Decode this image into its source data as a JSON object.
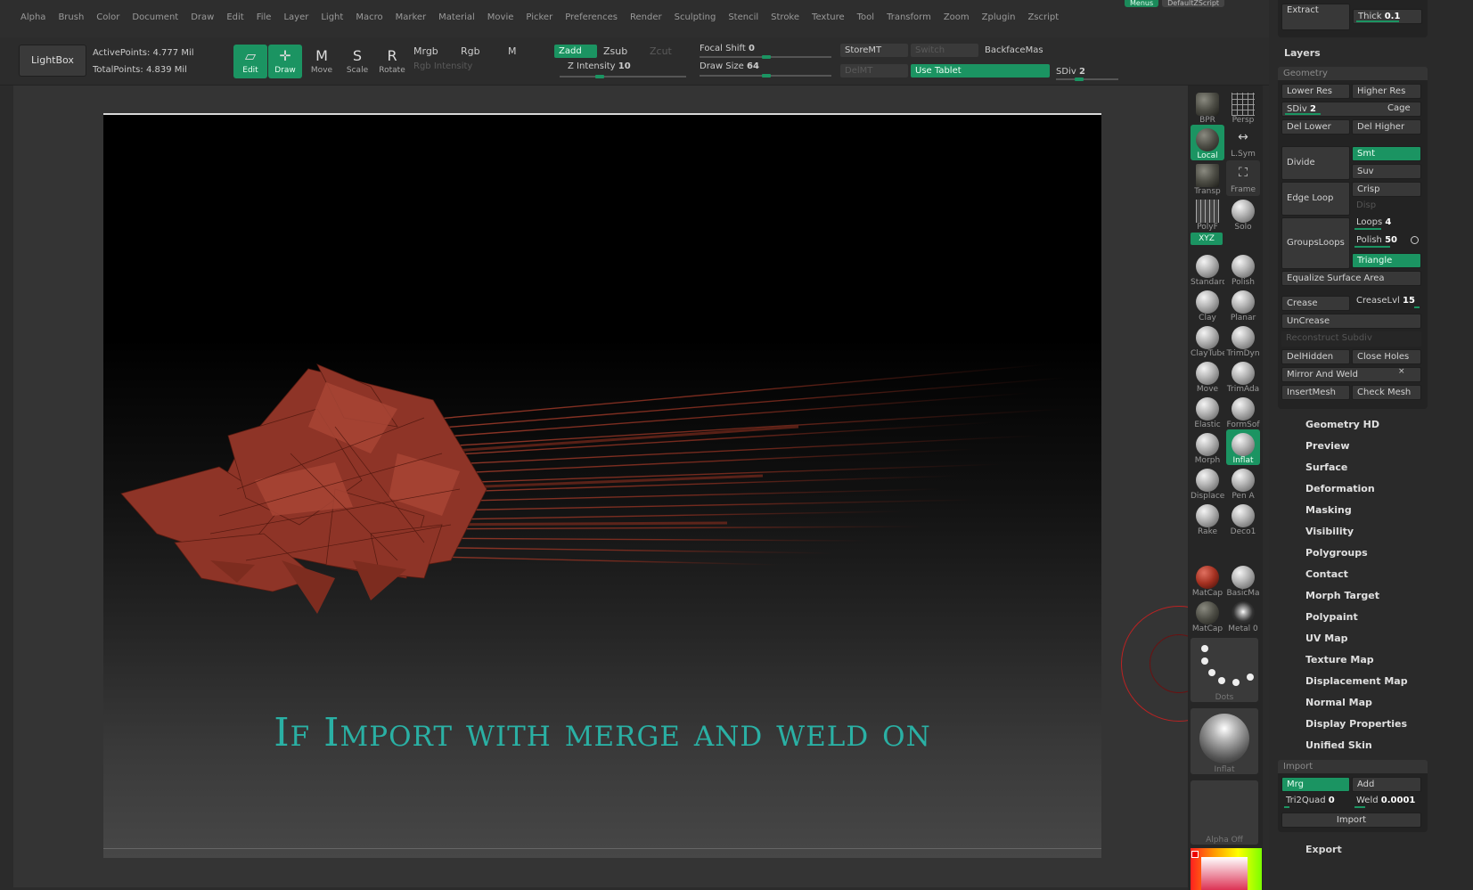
{
  "menubar": [
    "Alpha",
    "Brush",
    "Color",
    "Document",
    "Draw",
    "Edit",
    "File",
    "Layer",
    "Light",
    "Macro",
    "Marker",
    "Material",
    "Movie",
    "Picker",
    "Preferences",
    "Render",
    "Sculpting",
    "Stencil",
    "Stroke",
    "Texture",
    "Tool",
    "Transform",
    "Zoom",
    "Zplugin",
    "Zscript"
  ],
  "topright": {
    "menus": "Menus",
    "script": "DefaultZScript"
  },
  "shelf": {
    "lightbox": "LightBox",
    "active_points": "ActivePoints: 4.777  Mil",
    "total_points": "TotalPoints: 4.839  Mil",
    "edit": "Edit",
    "draw": "Draw",
    "move": "Move",
    "scale": "Scale",
    "rotate": "Rotate",
    "mrgb": "Mrgb",
    "rgb": "Rgb",
    "m": "M",
    "rgb_intensity": "Rgb  Intensity",
    "zadd": "Zadd",
    "zsub": "Zsub",
    "zcut": "Zcut",
    "z_intensity_label": "Z Intensity",
    "z_intensity": "10",
    "focal_shift_label": "Focal Shift",
    "focal_shift": "0",
    "draw_size_label": "Draw Size",
    "draw_size": "64",
    "store_mt": "StoreMT",
    "switch": "Switch",
    "backface": "BackfaceMas",
    "del_mt": "DelMT",
    "use_tablet": "Use Tablet",
    "sdiv_label": "SDiv",
    "sdiv": "2"
  },
  "canvas": {
    "caption": "If Import with merge and weld on"
  },
  "palette": {
    "view": [
      {
        "name": "bpr-button",
        "label": "BPR"
      },
      {
        "name": "persp-button",
        "label": "Persp"
      },
      {
        "name": "local-button",
        "label": "Local"
      },
      {
        "name": "lsym-button",
        "label": "L.Sym"
      },
      {
        "name": "transp-button",
        "label": "Transp"
      },
      {
        "name": "frame-button",
        "label": "Frame"
      },
      {
        "name": "polyf-button",
        "label": "PolyF"
      },
      {
        "name": "solo-button",
        "label": "Solo"
      }
    ],
    "xyz": "XYZ",
    "brushes": [
      "Standard",
      "Polish",
      "Clay",
      "Planar",
      "ClayTubes",
      "TrimDyn",
      "Move",
      "TrimAda",
      "Elastic",
      "FormSof",
      "Morph",
      "Inflat",
      "Displace",
      "Pen A",
      "Rake",
      "Deco1"
    ],
    "materials": [
      "MatCap",
      "BasicMa",
      "MatCap",
      "Metal 0"
    ],
    "stroke_label": "Dots",
    "alpha_brush_label": "Inflat",
    "alpha_label": "Alpha Off"
  },
  "rpanel": {
    "extract": "Extract",
    "thick_label": "Thick",
    "thick": "0.1",
    "layers": "Layers",
    "geometry": {
      "title": "Geometry",
      "lower_res": "Lower Res",
      "higher_res": "Higher Res",
      "sdiv_label": "SDiv",
      "sdiv": "2",
      "cage": "Cage",
      "del_lower": "Del Lower",
      "del_higher": "Del Higher",
      "divide": "Divide",
      "smt": "Smt",
      "suv": "Suv",
      "edge_loop": "Edge Loop",
      "crisp": "Crisp",
      "disp": "Disp",
      "groups_loops": "GroupsLoops",
      "loops_label": "Loops",
      "loops": "4",
      "polish_label": "Polish",
      "polish": "50",
      "triangle": "Triangle",
      "equalize": "Equalize Surface Area",
      "crease": "Crease",
      "crease_lvl_label": "CreaseLvl",
      "crease_lvl": "15",
      "uncrease": "UnCrease",
      "reconstruct": "Reconstruct Subdiv",
      "delhidden": "DelHidden",
      "close_holes": "Close Holes",
      "mirror_weld": "Mirror And Weld",
      "insertmesh": "InsertMesh",
      "check_mesh": "Check Mesh"
    },
    "sections": [
      "Geometry HD",
      "Preview",
      "Surface",
      "Deformation",
      "Masking",
      "Visibility",
      "Polygroups",
      "Contact",
      "Morph Target",
      "Polypaint",
      "UV Map",
      "Texture Map",
      "Displacement Map",
      "Normal Map",
      "Display Properties",
      "Unified Skin"
    ],
    "import": {
      "title": "Import",
      "mrg": "Mrg",
      "add": "Add",
      "tri2quad_label": "Tri2Quad",
      "tri2quad": "0",
      "weld_label": "Weld",
      "weld": "0.0001",
      "import_button": "Import"
    },
    "export": "Export"
  },
  "colors": {
    "accent": "#1b9462",
    "caption": "#2ab0a4",
    "model": "#8a2f20",
    "panel": "#2a2a2a"
  }
}
